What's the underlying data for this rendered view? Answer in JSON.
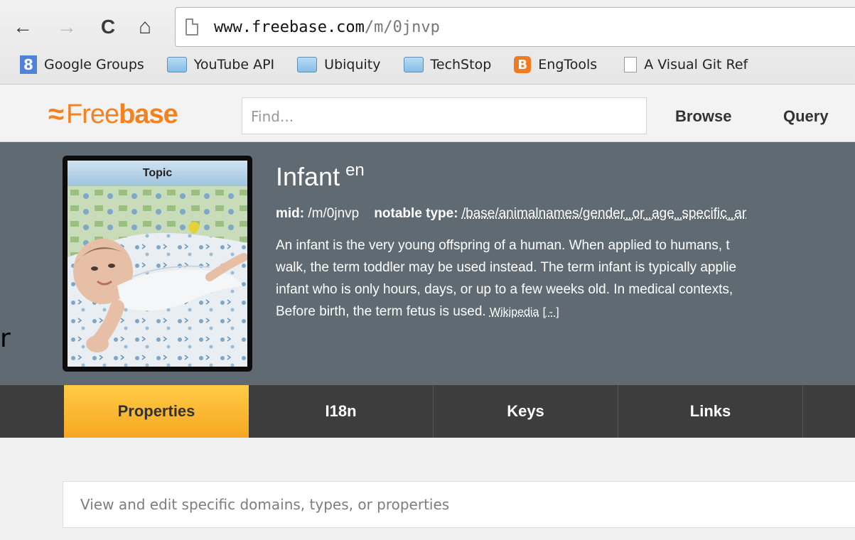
{
  "browser": {
    "url_host": "www.freebase.com",
    "url_path": "/m/0jnvp",
    "back_icon": "←",
    "forward_icon": "→",
    "reload_icon": "C",
    "home_icon": "⌂",
    "bookmarks": [
      {
        "label": "Google Groups",
        "icon": "google-groups-icon"
      },
      {
        "label": "YouTube API",
        "icon": "folder-icon"
      },
      {
        "label": "Ubiquity",
        "icon": "folder-icon"
      },
      {
        "label": "TechStop",
        "icon": "folder-icon"
      },
      {
        "label": "EngTools",
        "icon": "blogger-icon"
      },
      {
        "label": "A Visual Git Ref",
        "icon": "document-icon"
      }
    ]
  },
  "header": {
    "logo_free": "Free",
    "logo_base": "base",
    "search_placeholder": "Find...",
    "nav": [
      "Browse",
      "Query"
    ]
  },
  "topic": {
    "thumb_label": "Topic",
    "title": "Infant",
    "lang": "en",
    "mid_label": "mid:",
    "mid": "/m/0jnvp",
    "notable_label": "notable type:",
    "notable_type": "/base/animalnames/gender_or_age_specific_ar",
    "description_lines": [
      "An infant is the very young offspring of a human. When applied to humans, t",
      "walk, the term toddler may be used instead. The term infant is typically applie",
      "infant who is only hours, days, or up to a few weeks old. In medical contexts,",
      "Before birth, the term fetus is used."
    ],
    "wiki_link": "Wikipedia",
    "collapse_link": "[ - ]"
  },
  "tabs": [
    "Properties",
    "I18n",
    "Keys",
    "Links"
  ],
  "filter_placeholder": "View and edit specific domains, types, or properties",
  "side_fragment": "r",
  "colors": {
    "brand_orange": "#f5811f",
    "banner": "#5f6a72",
    "active_tab": "#f6a722"
  }
}
